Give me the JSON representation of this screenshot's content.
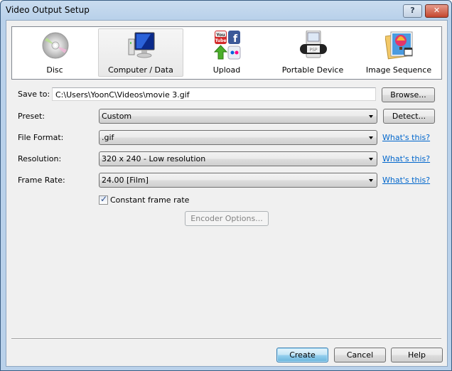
{
  "window": {
    "title": "Video Output Setup",
    "help_button": "?",
    "close_button": "✕"
  },
  "output_types": [
    {
      "label": "Disc",
      "icon": "disc-icon",
      "selected": false
    },
    {
      "label": "Computer / Data",
      "icon": "computer-icon",
      "selected": true
    },
    {
      "label": "Upload",
      "icon": "upload-icon",
      "selected": false
    },
    {
      "label": "Portable Device",
      "icon": "psp-icon",
      "selected": false
    },
    {
      "label": "Image Sequence",
      "icon": "image-sequence-icon",
      "selected": false
    }
  ],
  "form": {
    "save_to_label": "Save to:",
    "save_to_value": "C:\\Users\\YoonC\\Videos\\movie 3.gif",
    "browse_button": "Browse...",
    "preset_label": "Preset:",
    "preset_value": "Custom",
    "detect_button": "Detect...",
    "file_format_label": "File Format:",
    "file_format_value": ".gif",
    "resolution_label": "Resolution:",
    "resolution_value": "320 x 240 - Low resolution",
    "frame_rate_label": "Frame Rate:",
    "frame_rate_value": "24.00 [Film]",
    "whats_this": "What's this?",
    "constant_frame_rate_label": "Constant frame rate",
    "constant_frame_rate_checked": true,
    "encoder_options_button": "Encoder Options..."
  },
  "footer": {
    "create_button": "Create",
    "cancel_button": "Cancel",
    "help_button": "Help"
  }
}
